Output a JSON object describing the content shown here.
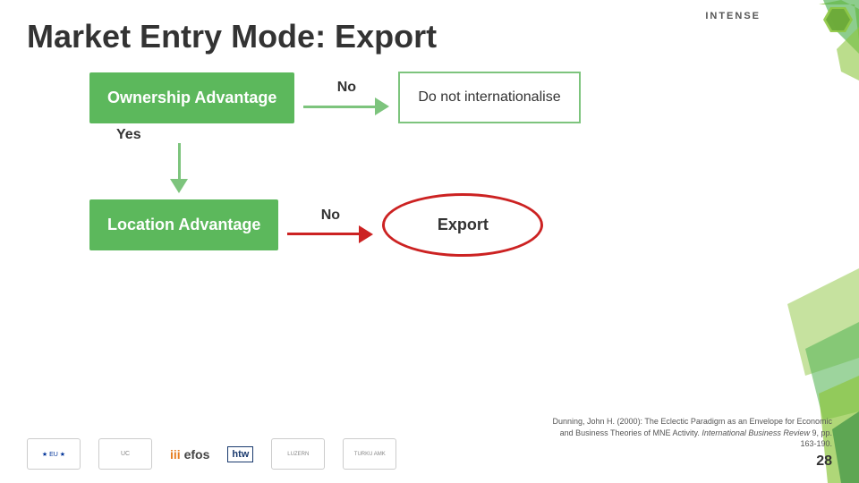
{
  "page": {
    "title": "Market Entry Mode: Export",
    "background": "#ffffff"
  },
  "logo": {
    "text": "INTENSE"
  },
  "diagram": {
    "ownership_box": "Ownership Advantage",
    "no_label_1": "No",
    "do_not_internationalise": "Do not internationalise",
    "yes_label": "Yes",
    "location_box": "Location Advantage",
    "no_label_2": "No",
    "export_label": "Export"
  },
  "footer": {
    "citation_text": "Dunning, John H. (2000): The Eclectic Paradigm as an Envelope for Economic and Business Theories of MNE Activity.",
    "citation_journal": "International Business Review",
    "citation_detail": "9, pp. 163-190.",
    "page_number": "28"
  }
}
